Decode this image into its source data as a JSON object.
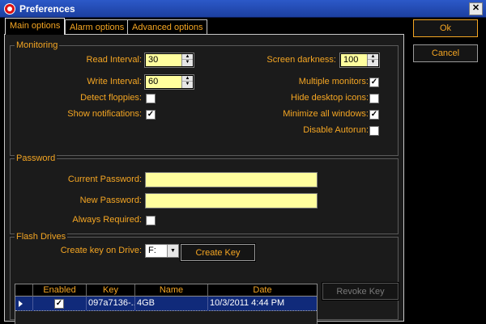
{
  "window": {
    "title": "Preferences",
    "close_glyph": "✕"
  },
  "tabs": [
    "Main options",
    "Alarm options",
    "Advanced options"
  ],
  "buttons": {
    "ok": "Ok",
    "cancel": "Cancel",
    "create_key": "Create Key",
    "revoke_key": "Revoke Key"
  },
  "monitoring": {
    "title": "Monitoring",
    "read_interval": {
      "label": "Read Interval:",
      "value": "30"
    },
    "write_interval": {
      "label": "Write Interval:",
      "value": "60"
    },
    "detect_floppies": {
      "label": "Detect floppies:",
      "checked": false
    },
    "show_notifications": {
      "label": "Show notifications:",
      "checked": true
    },
    "screen_darkness": {
      "label": "Screen darkness:",
      "value": "100"
    },
    "multiple_monitors": {
      "label": "Multiple monitors:",
      "checked": true
    },
    "hide_desktop_icons": {
      "label": "Hide desktop icons:",
      "checked": false
    },
    "minimize_all_windows": {
      "label": "Minimize all windows:",
      "checked": true
    },
    "disable_autorun": {
      "label": "Disable Autorun:",
      "checked": false
    }
  },
  "password": {
    "title": "Password",
    "current_label": "Current Password:",
    "new_label": "New Password:",
    "always_required": {
      "label": "Always Required:",
      "checked": false
    }
  },
  "flash": {
    "title": "Flash Drives",
    "create_label": "Create key on Drive:",
    "drive": "F:",
    "columns": [
      "Enabled",
      "Key",
      "Name",
      "Date"
    ],
    "rows": [
      {
        "enabled": true,
        "key": "097a7136-...",
        "name": "4GB",
        "date": "10/3/2011 4:44 PM"
      }
    ]
  },
  "colors": {
    "accent": "#f5a623",
    "field": "#fffe9e",
    "selection": "#102a7a",
    "titlebar": "#2c59c8"
  }
}
